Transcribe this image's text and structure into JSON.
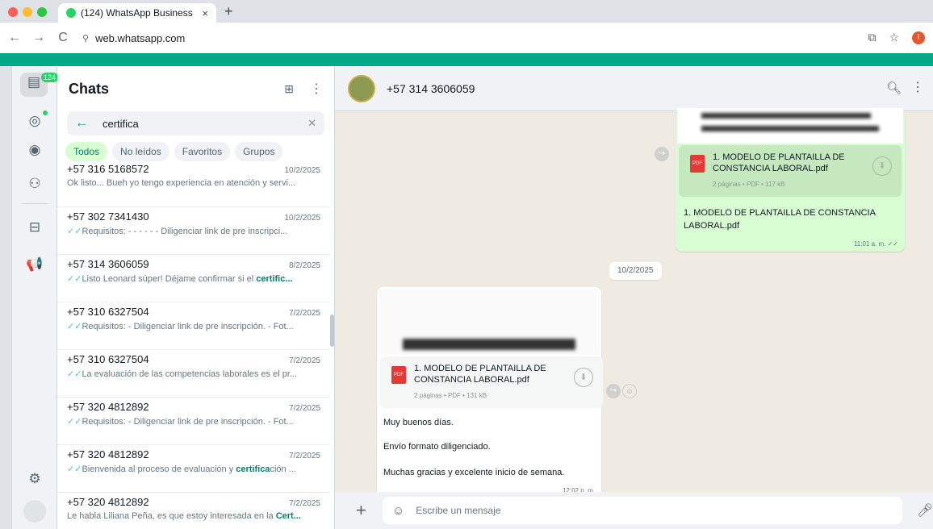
{
  "browser": {
    "tab_title": "(124) WhatsApp Business",
    "tab_close": "×",
    "new_tab": "+",
    "url": "web.whatsapp.com",
    "nav_back": "←",
    "nav_forward": "→",
    "reload": "C",
    "profile_initial": "I",
    "traffic_colors": [
      "#ff5f57",
      "#febc2e",
      "#28c840"
    ]
  },
  "rail": {
    "chats_badge": "124",
    "icons": [
      "chats-icon",
      "status-icon",
      "channels-icon",
      "communities-icon",
      "catalog-icon",
      "ads-icon",
      "settings-icon",
      "profile-avatar"
    ]
  },
  "sidebar": {
    "title": "Chats",
    "search_value": "certifica",
    "filters": [
      "Todos",
      "No leídos",
      "Favoritos",
      "Grupos"
    ],
    "chats": [
      {
        "name": "+57 316 5168572",
        "date": "10/2/2025",
        "ticks": "",
        "pre": "Ok listo... Bueh yo tengo experiencia en atención y servi...",
        "hl": "",
        "post": ""
      },
      {
        "name": "+57 302 7341430",
        "date": "10/2/2025",
        "ticks": "✓✓",
        "pre": "Requisitos:  - - - - - - Diligenciar link de pre inscripci...",
        "hl": "",
        "post": ""
      },
      {
        "name": "+57 314 3606059",
        "date": "8/2/2025",
        "ticks": "✓✓",
        "pre": "Listo Leonard súper!  Déjame confirmar si el ",
        "hl": "certific...",
        "post": ""
      },
      {
        "name": "+57 310 6327504",
        "date": "7/2/2025",
        "ticks": "✓✓",
        "pre": "Requisitos:  - Diligenciar link de pre inscripción.  - Fot...",
        "hl": "",
        "post": ""
      },
      {
        "name": "+57 310 6327504",
        "date": "7/2/2025",
        "ticks": "✓✓",
        "pre": "La evaluación de las competencias laborales es  el pr...",
        "hl": "",
        "post": ""
      },
      {
        "name": "+57 320 4812892",
        "date": "7/2/2025",
        "ticks": "✓✓",
        "pre": "Requisitos:  - Diligenciar link de pre inscripción.  - Fot...",
        "hl": "",
        "post": ""
      },
      {
        "name": "+57 320 4812892",
        "date": "7/2/2025",
        "ticks": "✓✓",
        "pre": "Bienvenida al proceso de evaluación y ",
        "hl": "certifica",
        "post": "ción ..."
      },
      {
        "name": "+57 320 4812892",
        "date": "7/2/2025",
        "ticks": "",
        "pre": "Le habla Liliana Peña, es que estoy interesada en la ",
        "hl": "Cert...",
        "post": ""
      }
    ]
  },
  "conversation": {
    "contact": "+57 314 3606059",
    "date_divider": "10/2/2025",
    "outgoing": {
      "doc_name": "1. MODELO DE PLANTAILLA DE CONSTANCIA LABORAL.pdf",
      "doc_meta": "2 páginas • PDF • 117 kB",
      "caption": "1. MODELO DE PLANTAILLA DE CONSTANCIA LABORAL.pdf",
      "time": "11:01 a. m. ✓✓"
    },
    "incoming": {
      "doc_name": "1. MODELO DE PLANTAILLA DE CONSTANCIA LABORAL.pdf",
      "doc_meta": "2 páginas • PDF • 131 kB",
      "line1": "Muy buenos días.",
      "line2": "Envío formato diligenciado.",
      "line3": "Muchas gracias y excelente inicio de semana.",
      "time": "12:02 p. m."
    },
    "pdf_badge": "PDF",
    "download_glyph": "⬇",
    "composer_placeholder": "Escribe un mensaje"
  }
}
